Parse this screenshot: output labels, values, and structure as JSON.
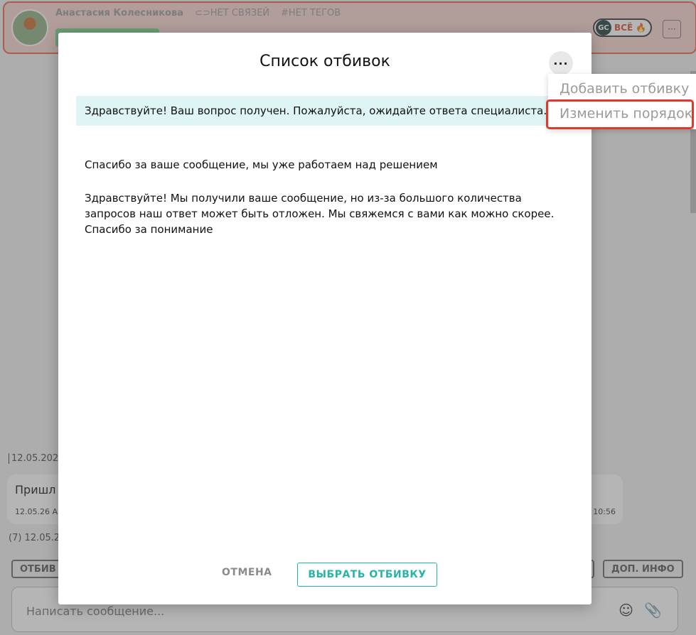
{
  "contact": {
    "name": "Анастасия Колесникова",
    "links": "⊂⊃НЕТ СВЯЗЕЙ",
    "tags": "#НЕТ ТЕГОВ",
    "channel_icon": "GC",
    "channel_label": "ВСЁ",
    "more_label": "···"
  },
  "chat": {
    "date": "12.05.202",
    "message_text": "Пришл",
    "message_time_left": "12.05.26 А",
    "message_time_right": "10:56",
    "meta": "(7) 12.05.2"
  },
  "tabs": {
    "left_label": "ОТБИВ",
    "right_label": "ДОП. ИНФО"
  },
  "composer": {
    "placeholder": "Написать сообщение..."
  },
  "modal": {
    "title": "Список отбивок",
    "more_label": "···",
    "replies": [
      "Здравствуйте! Ваш вопрос получен. Пожалуйста, ожидайте ответа специалиста.",
      "Спасибо за ваше сообщение, мы уже работаем над решением",
      "Здравствуйте! Мы получили ваше сообщение, но из-за большого количества запросов наш ответ может быть отложен. Мы свяжемся с вами как можно скорее. Спасибо за понимание"
    ],
    "cancel_label": "ОТМЕНА",
    "choose_label": "ВЫБРАТЬ ОТБИВКУ"
  },
  "dropdown": {
    "items": [
      "Добавить отбивку",
      "Изменить порядок"
    ]
  },
  "colors": {
    "accent": "#28b3a7",
    "highlight": "#e0382a",
    "selected_bg": "#dff4f4"
  }
}
